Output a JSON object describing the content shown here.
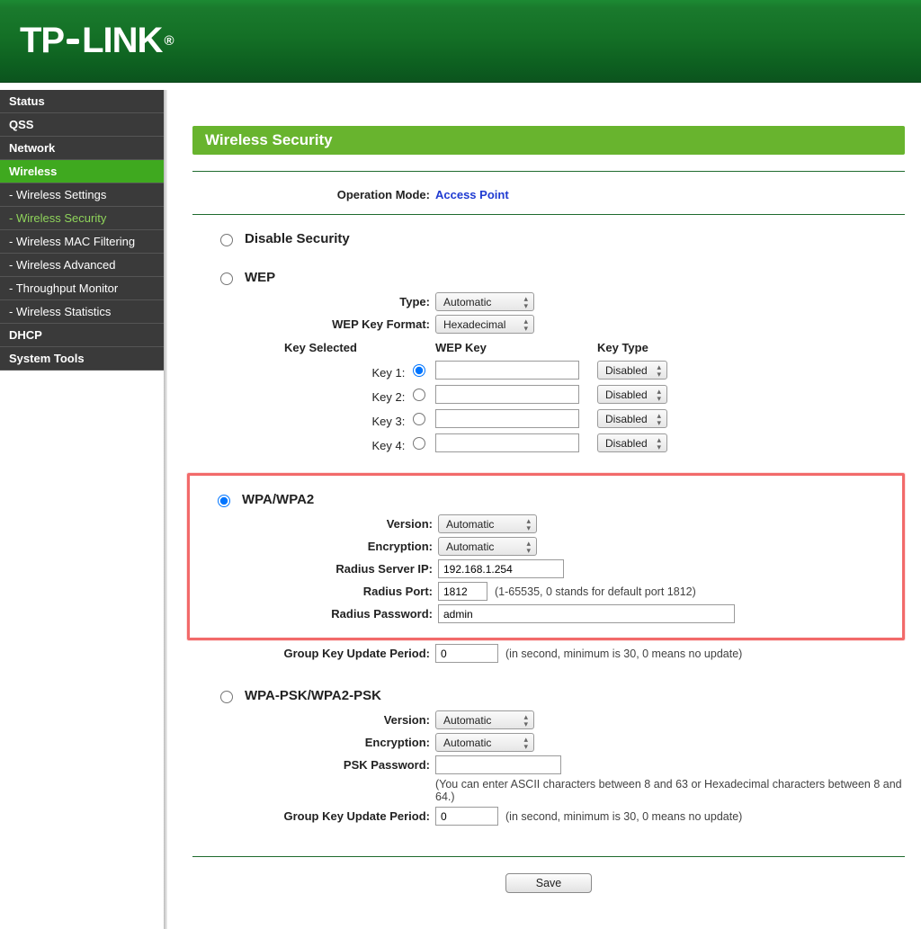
{
  "brand": "TP-LINK",
  "sidebar": {
    "items": [
      {
        "label": "Status",
        "type": "group"
      },
      {
        "label": "QSS",
        "type": "group"
      },
      {
        "label": "Network",
        "type": "group"
      },
      {
        "label": "Wireless",
        "type": "group",
        "active": true
      },
      {
        "label": "- Wireless Settings",
        "type": "sub"
      },
      {
        "label": "- Wireless Security",
        "type": "sub",
        "current": true
      },
      {
        "label": "- Wireless MAC Filtering",
        "type": "sub"
      },
      {
        "label": "- Wireless Advanced",
        "type": "sub"
      },
      {
        "label": "- Throughput Monitor",
        "type": "sub"
      },
      {
        "label": "- Wireless Statistics",
        "type": "sub"
      },
      {
        "label": "DHCP",
        "type": "group"
      },
      {
        "label": "System Tools",
        "type": "group"
      }
    ]
  },
  "page_title": "Wireless Security",
  "op_mode": {
    "label": "Operation Mode:",
    "value": "Access Point"
  },
  "disable_security": {
    "title": "Disable Security"
  },
  "wep": {
    "title": "WEP",
    "type": {
      "label": "Type:",
      "value": "Automatic"
    },
    "format": {
      "label": "WEP Key Format:",
      "value": "Hexadecimal"
    },
    "head": {
      "key_selected": "Key Selected",
      "wep_key": "WEP Key",
      "key_type": "Key Type"
    },
    "rows": [
      {
        "label": "Key 1:",
        "key": "",
        "type": "Disabled",
        "selected": true
      },
      {
        "label": "Key 2:",
        "key": "",
        "type": "Disabled",
        "selected": false
      },
      {
        "label": "Key 3:",
        "key": "",
        "type": "Disabled",
        "selected": false
      },
      {
        "label": "Key 4:",
        "key": "",
        "type": "Disabled",
        "selected": false
      }
    ]
  },
  "wpa": {
    "title": "WPA/WPA2",
    "version": {
      "label": "Version:",
      "value": "Automatic"
    },
    "encryption": {
      "label": "Encryption:",
      "value": "Automatic"
    },
    "radius_ip": {
      "label": "Radius Server IP:",
      "value": "192.168.1.254"
    },
    "radius_port": {
      "label": "Radius Port:",
      "value": "1812",
      "hint": "(1-65535, 0 stands for default port 1812)"
    },
    "radius_pw": {
      "label": "Radius Password:",
      "value": "admin"
    },
    "gkup": {
      "label": "Group Key Update Period:",
      "value": "0",
      "hint": "(in second, minimum is 30, 0 means no update)"
    }
  },
  "psk": {
    "title": "WPA-PSK/WPA2-PSK",
    "version": {
      "label": "Version:",
      "value": "Automatic"
    },
    "encryption": {
      "label": "Encryption:",
      "value": "Automatic"
    },
    "password": {
      "label": "PSK Password:",
      "value": ""
    },
    "pw_hint": "(You can enter ASCII characters between 8 and 63 or Hexadecimal characters between 8 and 64.)",
    "gkup": {
      "label": "Group Key Update Period:",
      "value": "0",
      "hint": "(in second, minimum is 30, 0 means no update)"
    }
  },
  "save_label": "Save"
}
